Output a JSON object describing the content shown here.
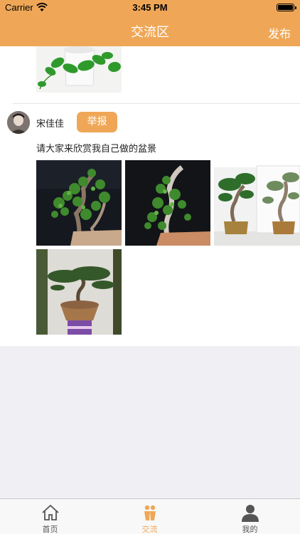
{
  "status": {
    "carrier": "Carrier",
    "time": "3:45 PM"
  },
  "nav": {
    "title": "交流区",
    "right_action": "发布"
  },
  "post": {
    "username": "宋佳佳",
    "report_label": "举报",
    "text": "请大家来欣赏我自己做的盆景",
    "photos": [
      "bonsai-photo-1",
      "bonsai-photo-2",
      "bonsai-photo-3",
      "bonsai-photo-4"
    ]
  },
  "tabbar": {
    "tabs": [
      {
        "label": "首页",
        "icon": "home-icon",
        "active": false
      },
      {
        "label": "交流",
        "icon": "people-icon",
        "active": true
      },
      {
        "label": "我的",
        "icon": "person-icon",
        "active": false
      }
    ]
  },
  "colors": {
    "accent": "#efa757",
    "background": "#efeff4",
    "tab_inactive": "#555555"
  }
}
